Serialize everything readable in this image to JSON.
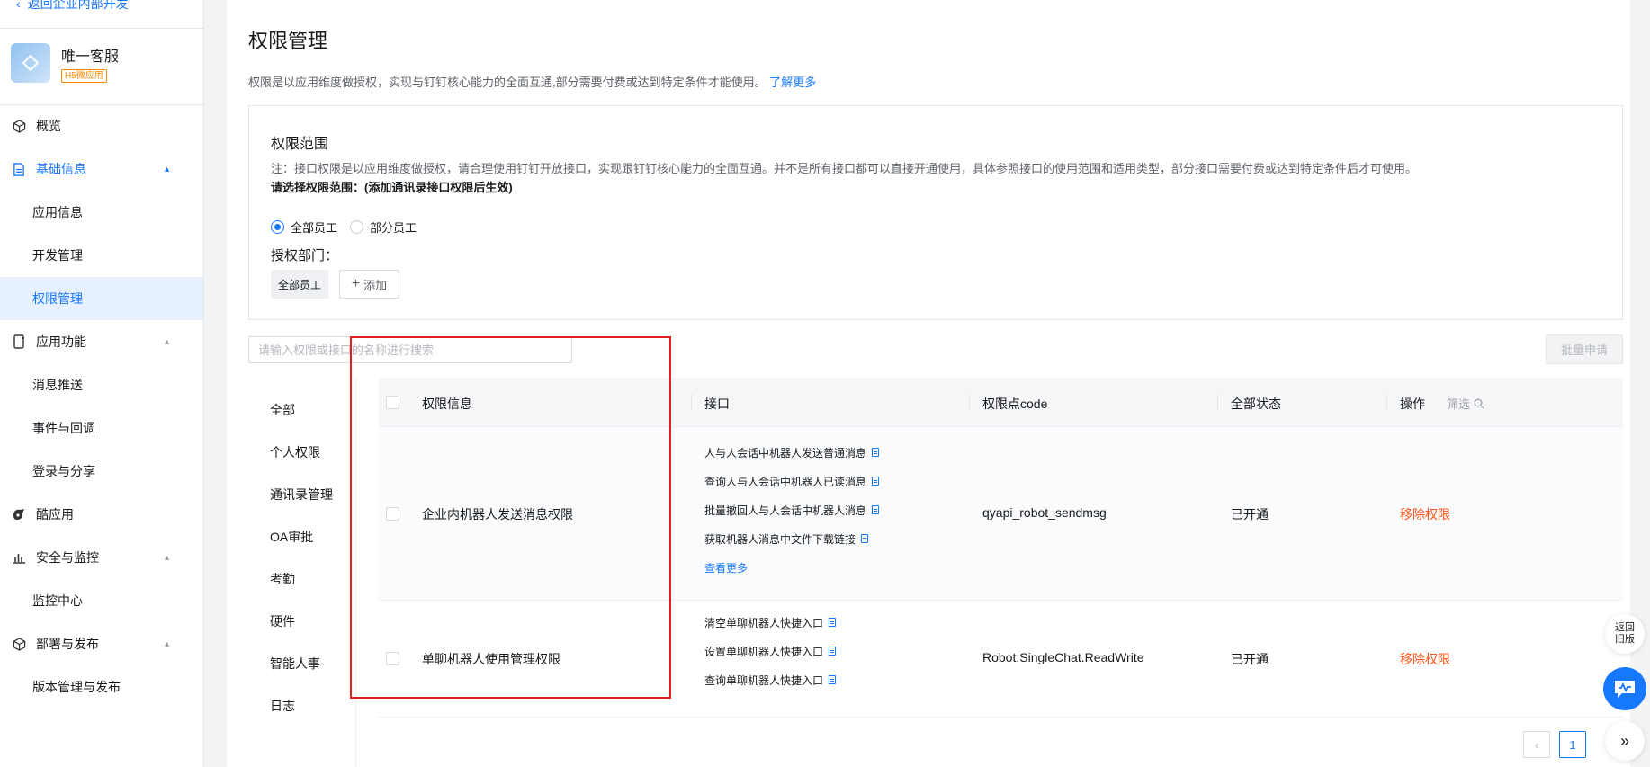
{
  "sidebar": {
    "back_label": "返回企业内部开发",
    "app_name": "唯一客服",
    "app_badge": "H5微应用",
    "items": [
      {
        "label": "概览",
        "icon": "cube-icon"
      },
      {
        "label": "基础信息",
        "icon": "document-icon",
        "expanded": true
      },
      {
        "label": "应用信息"
      },
      {
        "label": "开发管理"
      },
      {
        "label": "权限管理",
        "selected": true
      },
      {
        "label": "应用功能",
        "icon": "phone-app-icon"
      },
      {
        "label": "消息推送"
      },
      {
        "label": "事件与回调"
      },
      {
        "label": "登录与分享"
      },
      {
        "label": "酷应用",
        "icon": "cool-app-icon"
      },
      {
        "label": "安全与监控",
        "icon": "bar-chart-icon"
      },
      {
        "label": "监控中心"
      },
      {
        "label": "部署与发布",
        "icon": "cube-icon"
      },
      {
        "label": "版本管理与发布"
      }
    ]
  },
  "main": {
    "title": "权限管理",
    "desc": "权限是以应用维度做授权，实现与钉钉核心能力的全面互通,部分需要付费或达到特定条件才能使用。",
    "learn_more": "了解更多",
    "scope": {
      "title": "权限范围",
      "note": "注：接口权限是以应用维度做授权，请合理使用钉钉开放接口，实现跟钉钉核心能力的全面互通。并不是所有接口都可以直接开通使用，具体参照接口的使用范围和适用类型，部分接口需要付费或达到特定条件后才可使用。",
      "select_label": "请选择权限范围：(添加通讯录接口权限后生效)",
      "radio_all": "全部员工",
      "radio_part": "部分员工",
      "dept_label": "授权部门：",
      "dept_tag": "全部员工",
      "add_label": "添加"
    },
    "search_placeholder": "请输入权限或接口的名称进行搜索",
    "batch_label": "批量申请",
    "categories": [
      "全部",
      "个人权限",
      "通讯录管理",
      "OA审批",
      "考勤",
      "硬件",
      "智能人事",
      "日志"
    ],
    "table": {
      "headers": {
        "info": "权限信息",
        "api": "接口",
        "code": "权限点code",
        "status": "全部状态",
        "filter": "筛选",
        "action": "操作"
      },
      "rows": [
        {
          "name": "企业内机器人发送消息权限",
          "apis": [
            "人与人会话中机器人发送普通消息",
            "查询人与人会话中机器人已读消息",
            "批量撤回人与人会话中机器人消息",
            "获取机器人消息中文件下载链接"
          ],
          "more": "查看更多",
          "code": "qyapi_robot_sendmsg",
          "status": "已开通",
          "action": "移除权限"
        },
        {
          "name": "单聊机器人使用管理权限",
          "apis": [
            "清空单聊机器人快捷入口",
            "设置单聊机器人快捷入口",
            "查询单聊机器人快捷入口"
          ],
          "code": "Robot.SingleChat.ReadWrite",
          "status": "已开通",
          "action": "移除权限"
        }
      ]
    },
    "pagination": {
      "current": "1"
    }
  },
  "floating": {
    "old_version": "返回旧版"
  },
  "colors": {
    "primary": "#1677ff",
    "danger": "#ff5219",
    "highlight_box": "#e02020"
  }
}
